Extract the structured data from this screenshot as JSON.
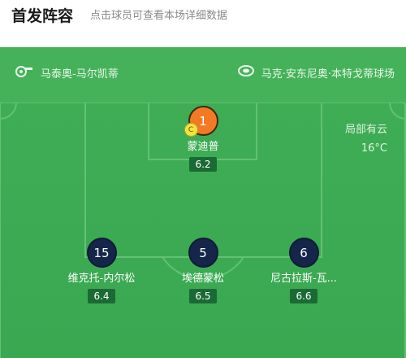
{
  "header": {
    "title": "首发阵容",
    "subtitle": "点击球员可查看本场详细数据"
  },
  "teams": {
    "home": {
      "name": "马泰奥-马尔凯蒂",
      "icon": "whistle-icon"
    },
    "away": {
      "name": "马克·安东尼奥·本特戈蒂球场",
      "icon": "stadium-icon"
    }
  },
  "weather": {
    "condition": "局部有云",
    "temperature": "16°C"
  },
  "players": [
    {
      "number": "1",
      "name": "蒙迪普",
      "rating": "6.2",
      "color": "#f37a24",
      "captain_mark": "C"
    },
    {
      "number": "15",
      "name": "维克托-内尔松",
      "rating": "6.4",
      "color": "#15264a"
    },
    {
      "number": "5",
      "name": "埃德蒙松",
      "rating": "6.5",
      "color": "#15264a"
    },
    {
      "number": "6",
      "name": "尼古拉斯-瓦...",
      "rating": "6.6",
      "color": "#15264a"
    }
  ]
}
